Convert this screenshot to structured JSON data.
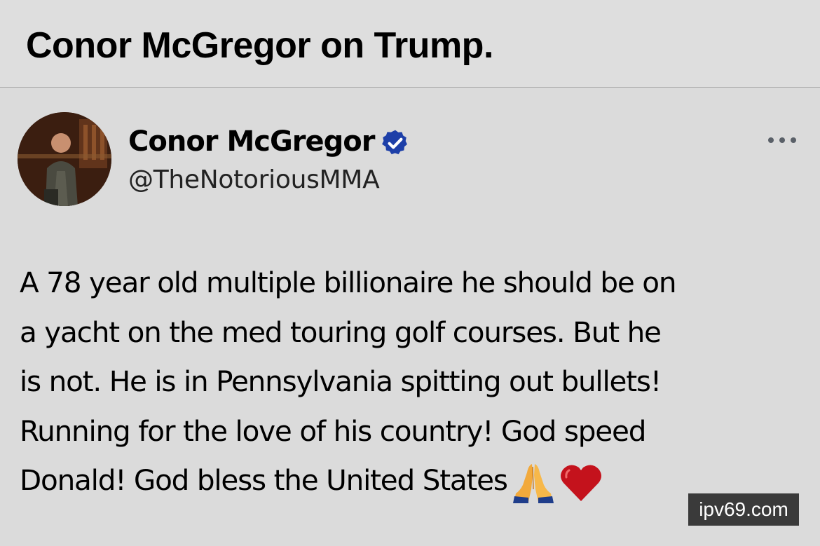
{
  "header": {
    "title": "Conor McGregor on Trump."
  },
  "tweet": {
    "author": {
      "name": "Conor McGregor",
      "handle": "@TheNotoriousMMA",
      "verified": true,
      "verified_color": "#1d3fa8"
    },
    "more_icon": "more-horizontal-icon",
    "text_lines": [
      "A 78 year old multiple billionaire he should be on",
      "a yacht on the med touring golf courses. But he",
      "is not. He is in Pennsylvania spitting out bullets!",
      "Running for the love of his country! God speed",
      "Donald! God bless the United States"
    ],
    "emojis": [
      "folded-hands-icon",
      "red-heart-icon"
    ]
  },
  "watermark": {
    "text": "ipv69.com"
  }
}
